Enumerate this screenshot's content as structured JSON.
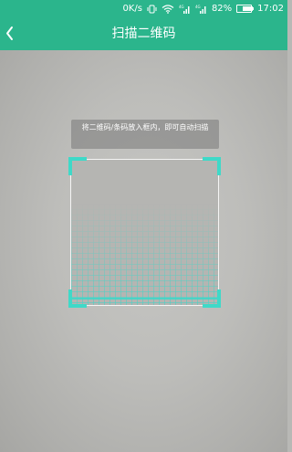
{
  "statusbar": {
    "network_speed": "0K/s",
    "vibrate_icon": "vibrate-icon",
    "wifi_icon": "wifi-icon",
    "signal_icon": "signal-icon",
    "battery_percent": "82%",
    "battery_level": 0.82,
    "time": "17:02"
  },
  "appbar": {
    "back_icon": "chevron-left-icon",
    "title": "扫描二维码"
  },
  "scanner": {
    "hint": "将二维码/条码放入框内，即可自动扫描",
    "accent_color": "#3fd9c8"
  },
  "colors": {
    "brand": "#2bb58c",
    "camera_background": "#bdbdba"
  }
}
